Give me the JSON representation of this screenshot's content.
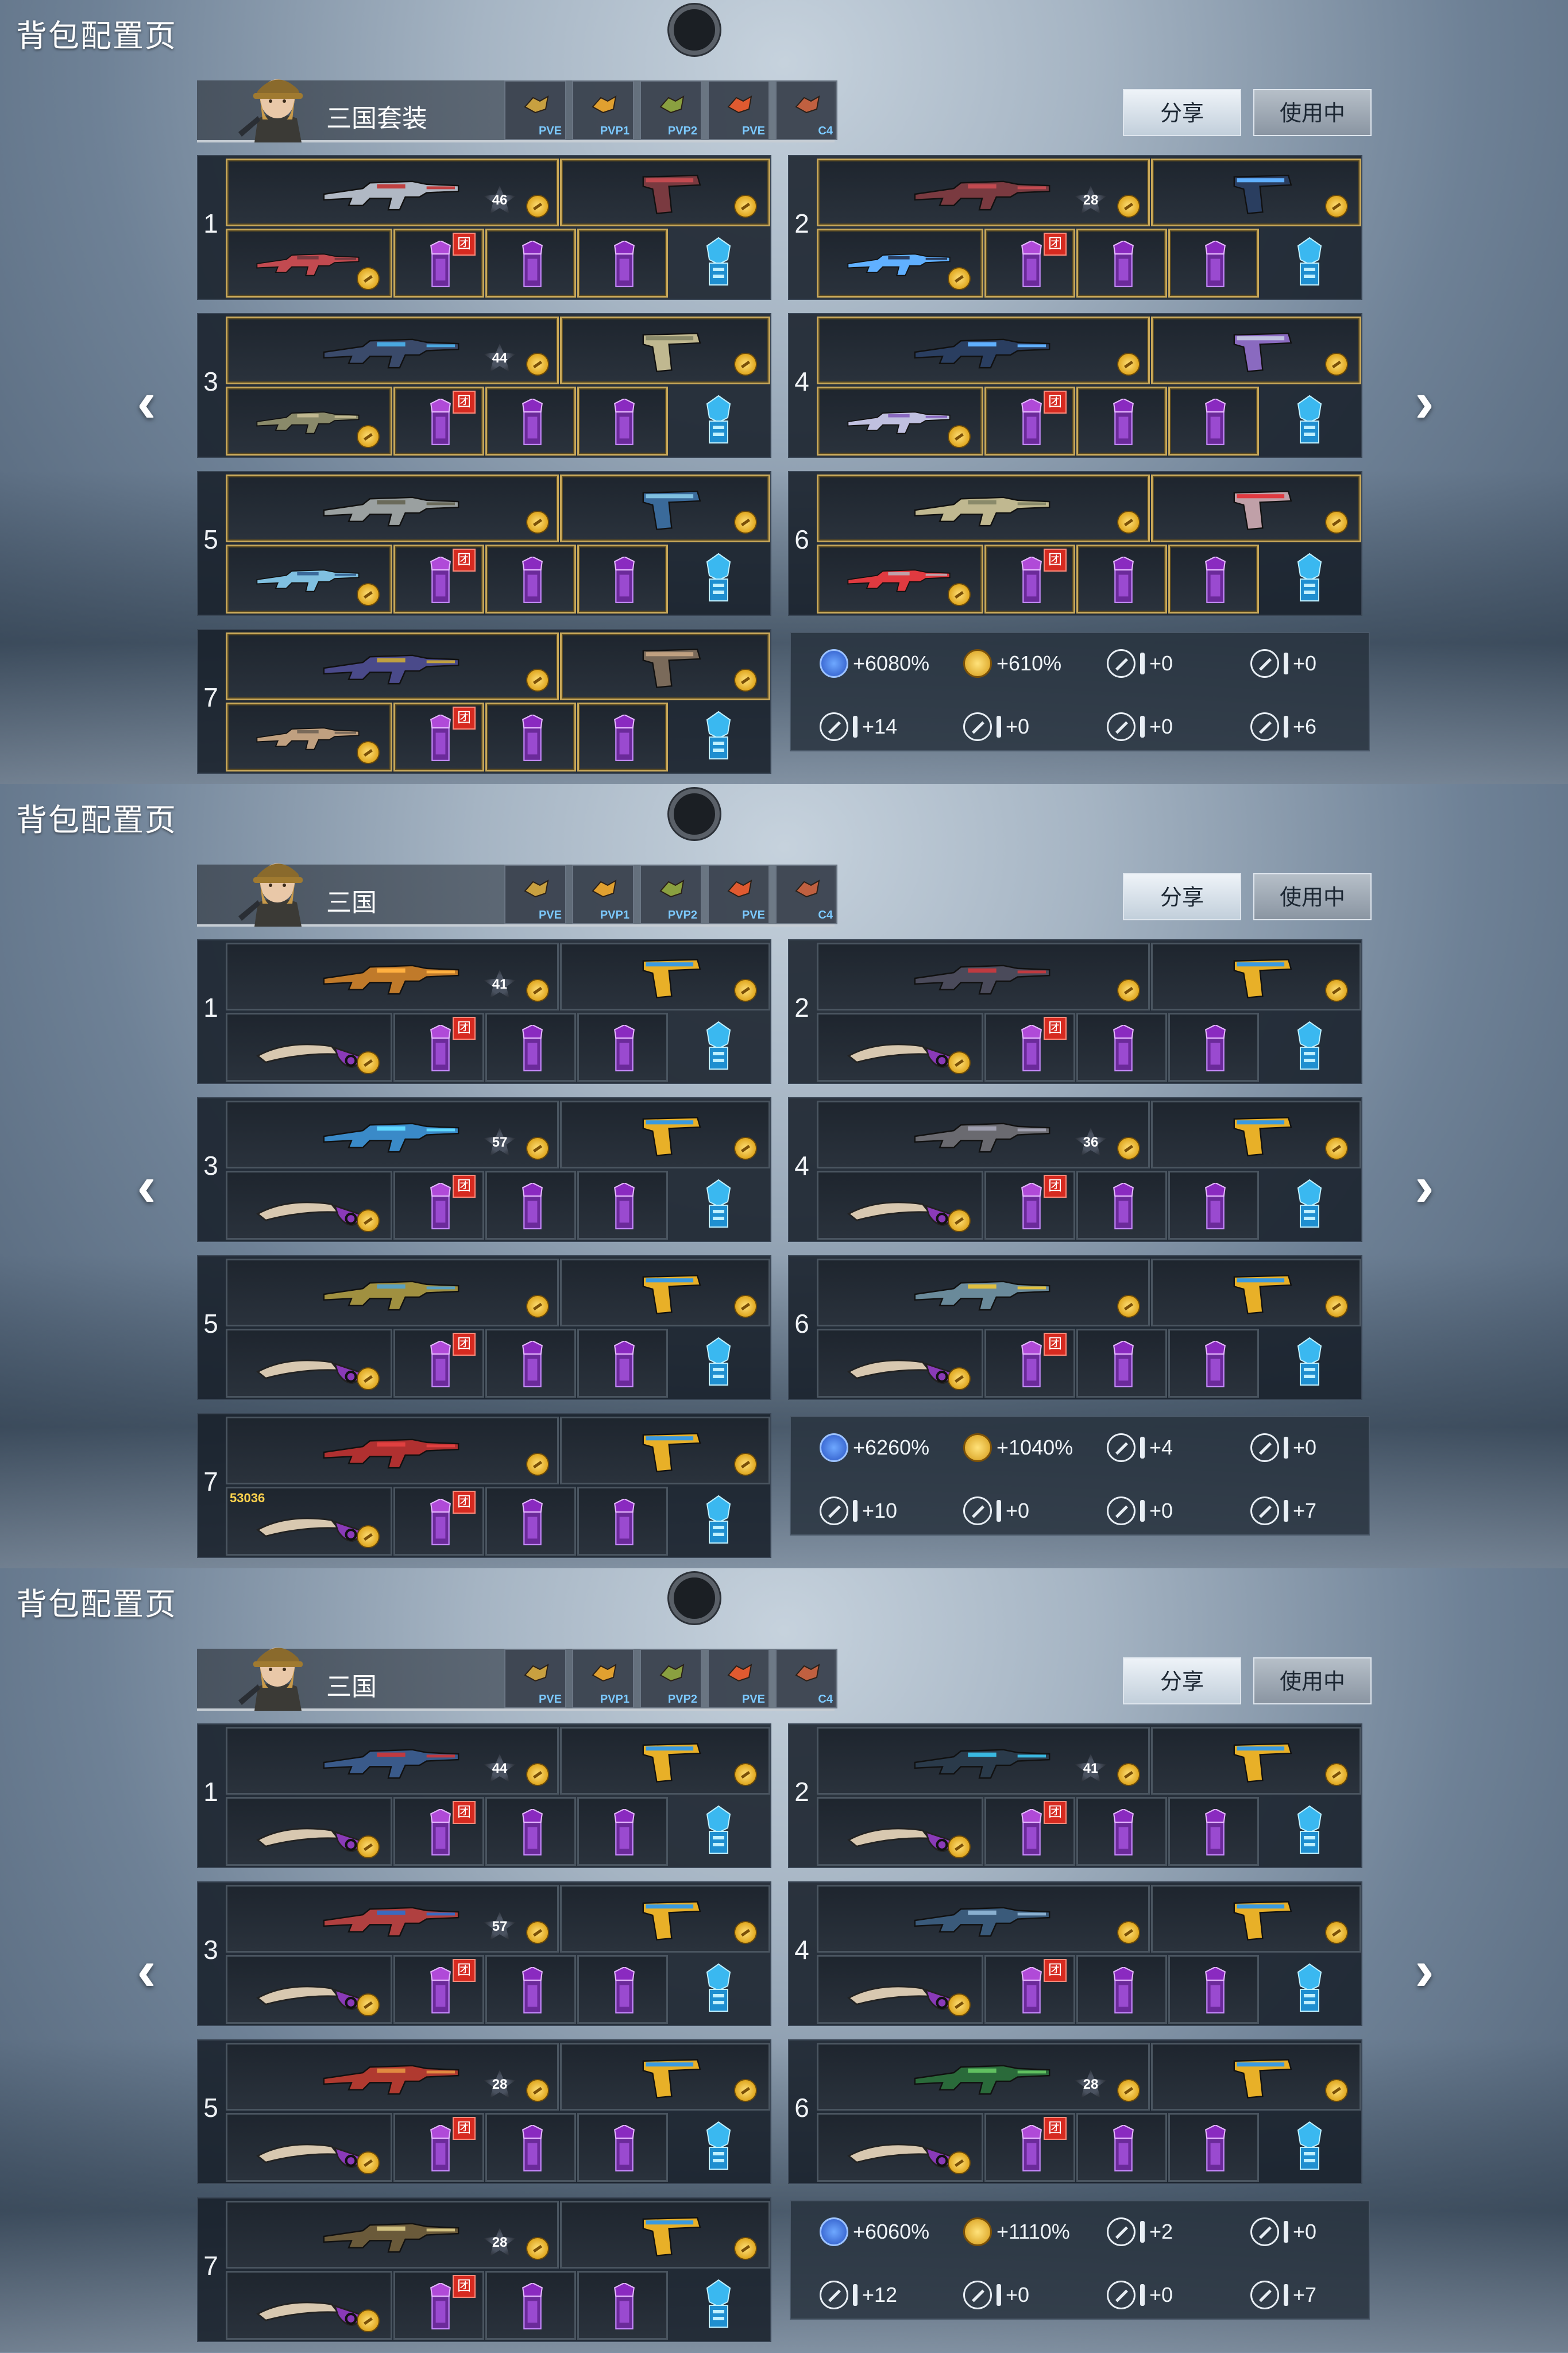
{
  "panels": [
    {
      "title": "背包配置页",
      "set_name": "三国套装",
      "modes": [
        "PVE",
        "PVP1",
        "PVP2",
        "PVE",
        "C4"
      ],
      "share_label": "分享",
      "inuse_label": "使用中",
      "slots": [
        {
          "num": "1",
          "rank": "46",
          "team_tag": "团"
        },
        {
          "num": "2",
          "rank": "28",
          "team_tag": "团"
        },
        {
          "num": "3",
          "rank": "44",
          "team_tag": "团"
        },
        {
          "num": "4",
          "rank": "",
          "team_tag": "团"
        },
        {
          "num": "5",
          "rank": "",
          "team_tag": "团"
        },
        {
          "num": "6",
          "rank": "",
          "team_tag": "团"
        },
        {
          "num": "7",
          "rank": "",
          "team_tag": "团"
        }
      ],
      "stats": [
        "+6080%",
        "+610%",
        "+0",
        "+0",
        "+14",
        "+0",
        "+0",
        "+6"
      ]
    },
    {
      "title": "背包配置页",
      "set_name": "三国",
      "modes": [
        "PVE",
        "PVP1",
        "PVP2",
        "PVE",
        "C4"
      ],
      "share_label": "分享",
      "inuse_label": "使用中",
      "slots": [
        {
          "num": "1",
          "rank": "41",
          "team_tag": "团"
        },
        {
          "num": "2",
          "rank": "",
          "team_tag": "团"
        },
        {
          "num": "3",
          "rank": "57",
          "team_tag": "团"
        },
        {
          "num": "4",
          "rank": "36",
          "team_tag": "团"
        },
        {
          "num": "5",
          "rank": "",
          "team_tag": "团"
        },
        {
          "num": "6",
          "rank": "",
          "team_tag": "团"
        },
        {
          "num": "7",
          "rank": "",
          "team_tag": "团"
        }
      ],
      "knife_tag": "53036",
      "stats": [
        "+6260%",
        "+1040%",
        "+4",
        "+0",
        "+10",
        "+0",
        "+0",
        "+7"
      ]
    },
    {
      "title": "背包配置页",
      "set_name": "三国",
      "modes": [
        "PVE",
        "PVP1",
        "PVP2",
        "PVE",
        "C4"
      ],
      "share_label": "分享",
      "inuse_label": "使用中",
      "slots": [
        {
          "num": "1",
          "rank": "44",
          "team_tag": "团"
        },
        {
          "num": "2",
          "rank": "41",
          "team_tag": "团"
        },
        {
          "num": "3",
          "rank": "57",
          "team_tag": "团"
        },
        {
          "num": "4",
          "rank": "",
          "team_tag": "团"
        },
        {
          "num": "5",
          "rank": "28",
          "team_tag": "团"
        },
        {
          "num": "6",
          "rank": "28",
          "team_tag": "团"
        },
        {
          "num": "7",
          "rank": "28",
          "team_tag": "团"
        }
      ],
      "stats": [
        "+6060%",
        "+1110%",
        "+2",
        "+0",
        "+12",
        "+0",
        "+0",
        "+7"
      ]
    }
  ],
  "icons": {
    "nav_prev": "chevron-left-icon",
    "nav_next": "chevron-right-icon",
    "camera": "camera-dot-icon",
    "coin": "gold-coin-icon",
    "exp": "exp-icon",
    "gold": "gold-bonus-icon"
  },
  "colors": {
    "gold_border": "#c8a85a",
    "mode_label": "#7cc9ff",
    "team_tag": "#d62a20",
    "purple_item": "#7a2fa8",
    "gem_blue": "#3ab8f0"
  }
}
